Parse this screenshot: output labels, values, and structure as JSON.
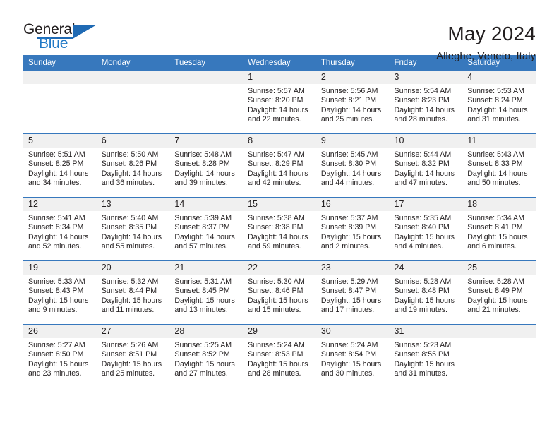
{
  "brand": {
    "name_top": "General",
    "name_bottom": "Blue",
    "accent_color": "#1f6ab4",
    "triangle_icon": "brand-triangle-icon"
  },
  "header": {
    "title": "May 2024",
    "subtitle": "Alleghe, Veneto, Italy"
  },
  "theme": {
    "header_bg": "#3778bd",
    "daynum_bg": "#f0f0f0",
    "row_border": "#3778bd",
    "text": "#231f20"
  },
  "weekday_headers": [
    "Sunday",
    "Monday",
    "Tuesday",
    "Wednesday",
    "Thursday",
    "Friday",
    "Saturday"
  ],
  "weeks": [
    [
      {
        "day": "",
        "lines": []
      },
      {
        "day": "",
        "lines": []
      },
      {
        "day": "",
        "lines": []
      },
      {
        "day": "1",
        "lines": [
          "Sunrise: 5:57 AM",
          "Sunset: 8:20 PM",
          "Daylight: 14 hours",
          "and 22 minutes."
        ]
      },
      {
        "day": "2",
        "lines": [
          "Sunrise: 5:56 AM",
          "Sunset: 8:21 PM",
          "Daylight: 14 hours",
          "and 25 minutes."
        ]
      },
      {
        "day": "3",
        "lines": [
          "Sunrise: 5:54 AM",
          "Sunset: 8:23 PM",
          "Daylight: 14 hours",
          "and 28 minutes."
        ]
      },
      {
        "day": "4",
        "lines": [
          "Sunrise: 5:53 AM",
          "Sunset: 8:24 PM",
          "Daylight: 14 hours",
          "and 31 minutes."
        ]
      }
    ],
    [
      {
        "day": "5",
        "lines": [
          "Sunrise: 5:51 AM",
          "Sunset: 8:25 PM",
          "Daylight: 14 hours",
          "and 34 minutes."
        ]
      },
      {
        "day": "6",
        "lines": [
          "Sunrise: 5:50 AM",
          "Sunset: 8:26 PM",
          "Daylight: 14 hours",
          "and 36 minutes."
        ]
      },
      {
        "day": "7",
        "lines": [
          "Sunrise: 5:48 AM",
          "Sunset: 8:28 PM",
          "Daylight: 14 hours",
          "and 39 minutes."
        ]
      },
      {
        "day": "8",
        "lines": [
          "Sunrise: 5:47 AM",
          "Sunset: 8:29 PM",
          "Daylight: 14 hours",
          "and 42 minutes."
        ]
      },
      {
        "day": "9",
        "lines": [
          "Sunrise: 5:45 AM",
          "Sunset: 8:30 PM",
          "Daylight: 14 hours",
          "and 44 minutes."
        ]
      },
      {
        "day": "10",
        "lines": [
          "Sunrise: 5:44 AM",
          "Sunset: 8:32 PM",
          "Daylight: 14 hours",
          "and 47 minutes."
        ]
      },
      {
        "day": "11",
        "lines": [
          "Sunrise: 5:43 AM",
          "Sunset: 8:33 PM",
          "Daylight: 14 hours",
          "and 50 minutes."
        ]
      }
    ],
    [
      {
        "day": "12",
        "lines": [
          "Sunrise: 5:41 AM",
          "Sunset: 8:34 PM",
          "Daylight: 14 hours",
          "and 52 minutes."
        ]
      },
      {
        "day": "13",
        "lines": [
          "Sunrise: 5:40 AM",
          "Sunset: 8:35 PM",
          "Daylight: 14 hours",
          "and 55 minutes."
        ]
      },
      {
        "day": "14",
        "lines": [
          "Sunrise: 5:39 AM",
          "Sunset: 8:37 PM",
          "Daylight: 14 hours",
          "and 57 minutes."
        ]
      },
      {
        "day": "15",
        "lines": [
          "Sunrise: 5:38 AM",
          "Sunset: 8:38 PM",
          "Daylight: 14 hours",
          "and 59 minutes."
        ]
      },
      {
        "day": "16",
        "lines": [
          "Sunrise: 5:37 AM",
          "Sunset: 8:39 PM",
          "Daylight: 15 hours",
          "and 2 minutes."
        ]
      },
      {
        "day": "17",
        "lines": [
          "Sunrise: 5:35 AM",
          "Sunset: 8:40 PM",
          "Daylight: 15 hours",
          "and 4 minutes."
        ]
      },
      {
        "day": "18",
        "lines": [
          "Sunrise: 5:34 AM",
          "Sunset: 8:41 PM",
          "Daylight: 15 hours",
          "and 6 minutes."
        ]
      }
    ],
    [
      {
        "day": "19",
        "lines": [
          "Sunrise: 5:33 AM",
          "Sunset: 8:43 PM",
          "Daylight: 15 hours",
          "and 9 minutes."
        ]
      },
      {
        "day": "20",
        "lines": [
          "Sunrise: 5:32 AM",
          "Sunset: 8:44 PM",
          "Daylight: 15 hours",
          "and 11 minutes."
        ]
      },
      {
        "day": "21",
        "lines": [
          "Sunrise: 5:31 AM",
          "Sunset: 8:45 PM",
          "Daylight: 15 hours",
          "and 13 minutes."
        ]
      },
      {
        "day": "22",
        "lines": [
          "Sunrise: 5:30 AM",
          "Sunset: 8:46 PM",
          "Daylight: 15 hours",
          "and 15 minutes."
        ]
      },
      {
        "day": "23",
        "lines": [
          "Sunrise: 5:29 AM",
          "Sunset: 8:47 PM",
          "Daylight: 15 hours",
          "and 17 minutes."
        ]
      },
      {
        "day": "24",
        "lines": [
          "Sunrise: 5:28 AM",
          "Sunset: 8:48 PM",
          "Daylight: 15 hours",
          "and 19 minutes."
        ]
      },
      {
        "day": "25",
        "lines": [
          "Sunrise: 5:28 AM",
          "Sunset: 8:49 PM",
          "Daylight: 15 hours",
          "and 21 minutes."
        ]
      }
    ],
    [
      {
        "day": "26",
        "lines": [
          "Sunrise: 5:27 AM",
          "Sunset: 8:50 PM",
          "Daylight: 15 hours",
          "and 23 minutes."
        ]
      },
      {
        "day": "27",
        "lines": [
          "Sunrise: 5:26 AM",
          "Sunset: 8:51 PM",
          "Daylight: 15 hours",
          "and 25 minutes."
        ]
      },
      {
        "day": "28",
        "lines": [
          "Sunrise: 5:25 AM",
          "Sunset: 8:52 PM",
          "Daylight: 15 hours",
          "and 27 minutes."
        ]
      },
      {
        "day": "29",
        "lines": [
          "Sunrise: 5:24 AM",
          "Sunset: 8:53 PM",
          "Daylight: 15 hours",
          "and 28 minutes."
        ]
      },
      {
        "day": "30",
        "lines": [
          "Sunrise: 5:24 AM",
          "Sunset: 8:54 PM",
          "Daylight: 15 hours",
          "and 30 minutes."
        ]
      },
      {
        "day": "31",
        "lines": [
          "Sunrise: 5:23 AM",
          "Sunset: 8:55 PM",
          "Daylight: 15 hours",
          "and 31 minutes."
        ]
      },
      {
        "day": "",
        "lines": []
      }
    ]
  ]
}
